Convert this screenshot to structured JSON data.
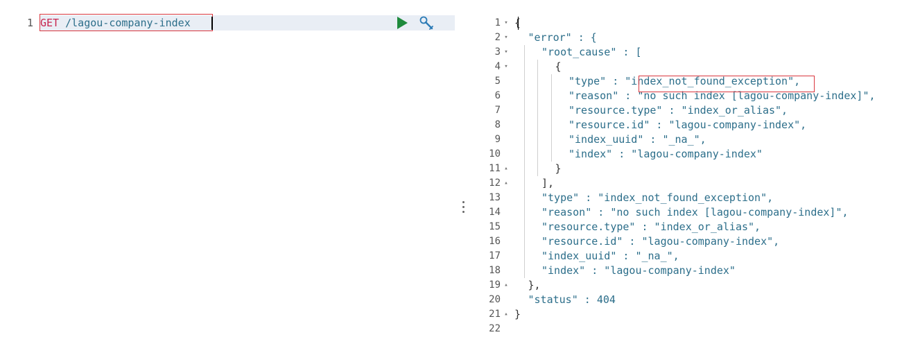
{
  "request_editor": {
    "line_number": "1",
    "method": "GET",
    "path": " /lagou-company-index",
    "run_icon": "play-icon",
    "settings_icon": "wrench-icon"
  },
  "response_editor": {
    "lines": [
      {
        "num": "1",
        "fold": "▾",
        "indent": 0,
        "code": "{"
      },
      {
        "num": "2",
        "fold": "▾",
        "indent": 1,
        "key": "\"error\"",
        "rest": " : {"
      },
      {
        "num": "3",
        "fold": "▾",
        "indent": 2,
        "key": "\"root_cause\"",
        "rest": " : ["
      },
      {
        "num": "4",
        "fold": "▾",
        "indent": 3,
        "code": "{"
      },
      {
        "num": "5",
        "fold": "",
        "indent": 4,
        "key": "\"type\"",
        "rest": " : \"index_not_found_exception\","
      },
      {
        "num": "6",
        "fold": "",
        "indent": 4,
        "key": "\"reason\"",
        "rest": " : \"no such index [lagou-company-index]\","
      },
      {
        "num": "7",
        "fold": "",
        "indent": 4,
        "key": "\"resource.type\"",
        "rest": " : \"index_or_alias\","
      },
      {
        "num": "8",
        "fold": "",
        "indent": 4,
        "key": "\"resource.id\"",
        "rest": " : \"lagou-company-index\","
      },
      {
        "num": "9",
        "fold": "",
        "indent": 4,
        "key": "\"index_uuid\"",
        "rest": " : \"_na_\","
      },
      {
        "num": "10",
        "fold": "",
        "indent": 4,
        "key": "\"index\"",
        "rest": " : \"lagou-company-index\""
      },
      {
        "num": "11",
        "fold": "▴",
        "indent": 3,
        "code": "}"
      },
      {
        "num": "12",
        "fold": "▴",
        "indent": 2,
        "code": "],"
      },
      {
        "num": "13",
        "fold": "",
        "indent": 2,
        "key": "\"type\"",
        "rest": " : \"index_not_found_exception\","
      },
      {
        "num": "14",
        "fold": "",
        "indent": 2,
        "key": "\"reason\"",
        "rest": " : \"no such index [lagou-company-index]\","
      },
      {
        "num": "15",
        "fold": "",
        "indent": 2,
        "key": "\"resource.type\"",
        "rest": " : \"index_or_alias\","
      },
      {
        "num": "16",
        "fold": "",
        "indent": 2,
        "key": "\"resource.id\"",
        "rest": " : \"lagou-company-index\","
      },
      {
        "num": "17",
        "fold": "",
        "indent": 2,
        "key": "\"index_uuid\"",
        "rest": " : \"_na_\","
      },
      {
        "num": "18",
        "fold": "",
        "indent": 2,
        "key": "\"index\"",
        "rest": " : \"lagou-company-index\""
      },
      {
        "num": "19",
        "fold": "▴",
        "indent": 1,
        "code": "},"
      },
      {
        "num": "20",
        "fold": "",
        "indent": 1,
        "key": "\"status\"",
        "rest": " : 404"
      },
      {
        "num": "21",
        "fold": "▴",
        "indent": 0,
        "code": "}"
      },
      {
        "num": "22",
        "fold": "",
        "indent": 0,
        "code": ""
      }
    ]
  },
  "colors": {
    "highlight_border": "#d9363e",
    "run_button": "#1e8a3c",
    "json_key": "#2c6e8a",
    "method": "#c7254e"
  }
}
